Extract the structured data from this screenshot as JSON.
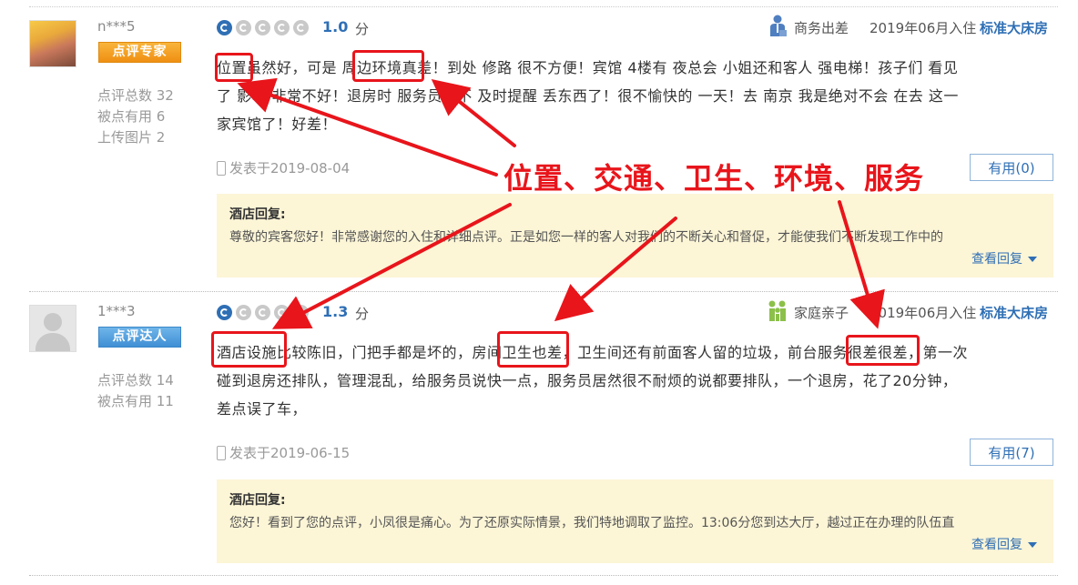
{
  "reviews": [
    {
      "username": "n***5",
      "badge": "点评专家",
      "stats": [
        "点评总数 32",
        "被点有用 6",
        "上传图片 2"
      ],
      "score": "1.0",
      "score_unit": "分",
      "score_filled": 1,
      "trip_type": "商务出差",
      "stay_date": "2019年06月入住",
      "room_type": "标准大床房",
      "text_lines": [
        "位置虽然好，可是 周边环境真差！到处 修路 很不方便！宾馆 4楼有 夜总会 小姐还和客人 强电梯！孩子们 看见",
        "了 影响 非常不好！退房时 服务员也不 及时提醒 丢东西了！很不愉快的 一天！去 南京 我是绝对不会 在去 这一",
        "家宾馆了！好差！"
      ],
      "posted": "发表于2019-08-04",
      "useful": "有用(0)",
      "reply_title": "酒店回复:",
      "reply_text": "尊敬的宾客您好！非常感谢您的入住和详细点评。正是如您一样的客人对我们的不断关心和督促，才能使我们不断发现工作中的",
      "view_reply": "查看回复"
    },
    {
      "username": "1***3",
      "badge": "点评达人",
      "stats": [
        "点评总数 14",
        "被点有用 11"
      ],
      "score": "1.3",
      "score_unit": "分",
      "score_filled": 1,
      "trip_type": "家庭亲子",
      "stay_date": "2019年06月入住",
      "room_type": "标准大床房",
      "text_lines": [
        "酒店设施比较陈旧，门把手都是坏的，房间卫生也差，卫生间还有前面客人留的垃圾，前台服务很差很差，第一次",
        "碰到退房还排队，管理混乱，给服务员说快一点，服务员居然很不耐烦的说都要排队，一个退房，花了20分钟，",
        "差点误了车，"
      ],
      "posted": "发表于2019-06-15",
      "useful": "有用(7)",
      "reply_title": "酒店回复:",
      "reply_text": "您好！看到了您的点评，小凤很是痛心。为了还原实际情景，我们特地调取了监控。13:06分您到达大厅，越过正在办理的队伍直",
      "view_reply": "查看回复"
    }
  ],
  "annotation": {
    "label": "位置、交通、卫生、环境、服务",
    "color": "#e8151b"
  },
  "colors": {
    "accent": "#2f6fb5",
    "reply_bg": "#fcf5d6",
    "expert_badge": "#f5a623",
    "talent_badge": "#4a9be0"
  }
}
